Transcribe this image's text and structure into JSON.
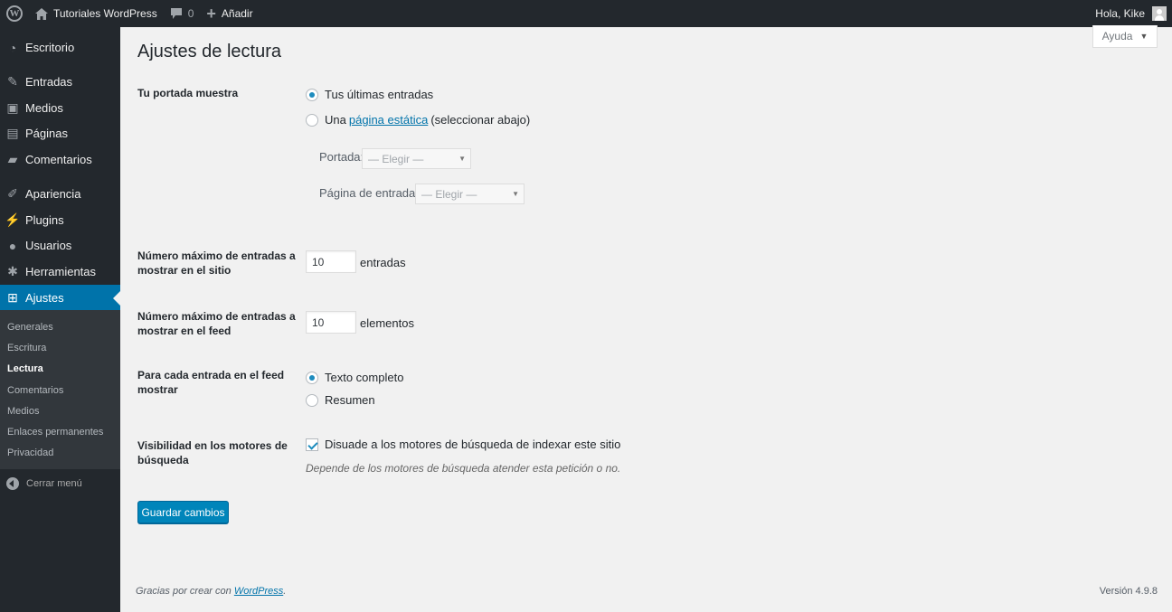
{
  "admin_bar": {
    "site_name": "Tutoriales WordPress",
    "comments_count": "0",
    "new_label": "Añadir",
    "greeting": "Hola, Kike"
  },
  "sidebar": {
    "items": [
      {
        "label": "Escritorio",
        "icon": "dashboard-icon"
      },
      {
        "label": "Entradas",
        "icon": "pin-icon"
      },
      {
        "label": "Medios",
        "icon": "media-icon"
      },
      {
        "label": "Páginas",
        "icon": "page-icon"
      },
      {
        "label": "Comentarios",
        "icon": "comment-icon"
      },
      {
        "label": "Apariencia",
        "icon": "brush-icon"
      },
      {
        "label": "Plugins",
        "icon": "plugin-icon"
      },
      {
        "label": "Usuarios",
        "icon": "user-icon"
      },
      {
        "label": "Herramientas",
        "icon": "wrench-icon"
      },
      {
        "label": "Ajustes",
        "icon": "settings-icon"
      }
    ],
    "submenu": [
      "Generales",
      "Escritura",
      "Lectura",
      "Comentarios",
      "Medios",
      "Enlaces permanentes",
      "Privacidad"
    ],
    "collapse_label": "Cerrar menú"
  },
  "help_tab": "Ayuda",
  "page_title": "Ajustes de lectura",
  "front_page": {
    "label": "Tu portada muestra",
    "option_latest": "Tus últimas entradas",
    "option_static_prefix": "Una",
    "option_static_link": "página estática",
    "option_static_suffix": "(seleccionar abajo)",
    "portada_label": "Portada:",
    "portada_value": "— Elegir —",
    "posts_page_label": "Página de entradas:",
    "posts_page_value": "— Elegir —"
  },
  "posts_per_page": {
    "label": "Número máximo de entradas a mostrar en el sitio",
    "value": "10",
    "unit": "entradas"
  },
  "posts_per_rss": {
    "label": "Número máximo de entradas a mostrar en el feed",
    "value": "10",
    "unit": "elementos"
  },
  "feed_display": {
    "label": "Para cada entrada en el feed mostrar",
    "option_full": "Texto completo",
    "option_summary": "Resumen"
  },
  "search_visibility": {
    "label": "Visibilidad en los motores de búsqueda",
    "checkbox_label": "Disuade a los motores de búsqueda de indexar este sitio",
    "description": "Depende de los motores de búsqueda atender esta petición o no."
  },
  "save_button": "Guardar cambios",
  "footer": {
    "thanks_prefix": "Gracias por crear con",
    "thanks_link": "WordPress",
    "thanks_suffix": ".",
    "version": "Versión 4.9.8"
  }
}
